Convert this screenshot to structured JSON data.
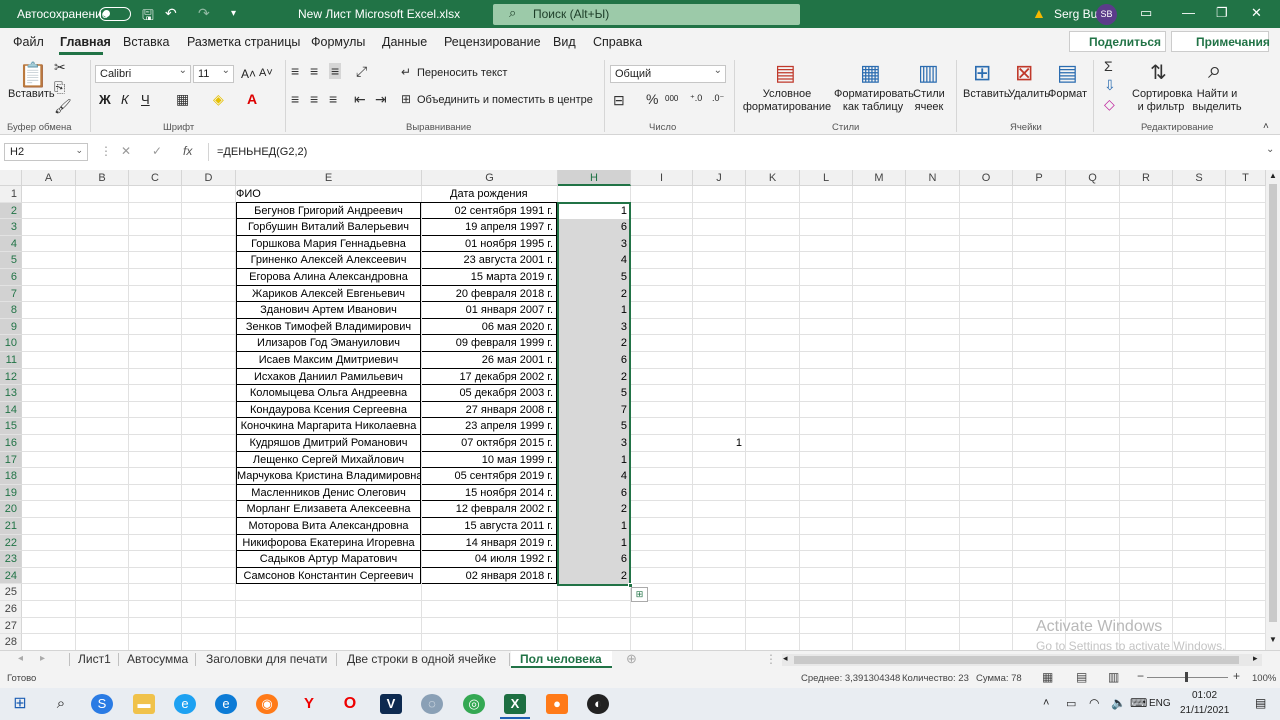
{
  "titlebar": {
    "autosave_label": "Автосохранение",
    "filename": "New Лист Microsoft Excel.xlsx",
    "search_placeholder": "Поиск (Alt+Ы)",
    "user_name": "Serg Bul",
    "user_initials": "SB"
  },
  "menu": {
    "items": [
      "Файл",
      "Главная",
      "Вставка",
      "Разметка страницы",
      "Формулы",
      "Данные",
      "Рецензирование",
      "Вид",
      "Справка"
    ],
    "active": "Главная",
    "share_label": "Поделиться",
    "notes_label": "Примечания"
  },
  "ribbon": {
    "paste_label": "Вставить",
    "clipboard_group": "Буфер обмена",
    "font_name": "Calibri",
    "font_size": "11",
    "font_group": "Шрифт",
    "wrap_text": "Переносить текст",
    "merge_center": "Объединить и поместить в центре",
    "alignment_group": "Выравнивание",
    "number_format": "Общий",
    "number_group": "Число",
    "conditional_formatting": "Условное форматирование",
    "format_as_table": "Форматировать как таблицу",
    "cell_styles": "Стили ячеек",
    "styles_group": "Стили",
    "insert_label": "Вставить",
    "delete_label": "Удалить",
    "format_label": "Формат",
    "cells_group": "Ячейки",
    "sort_filter": "Сортировка и фильтр",
    "find_select": "Найти и выделить",
    "editing_group": "Редактирование"
  },
  "formula_bar": {
    "name_box": "H2",
    "formula": "=ДЕНЬНЕД(G2,2)"
  },
  "grid": {
    "columns": [
      "A",
      "B",
      "C",
      "D",
      "E",
      "G",
      "H",
      "I",
      "J",
      "K",
      "L",
      "M",
      "N",
      "O",
      "P",
      "Q",
      "R",
      "S",
      "T"
    ],
    "selected_column": "H",
    "header_fio": "ФИО",
    "header_dob": "Дата рождения",
    "rows": [
      {
        "fio": "Бегунов Григорий Андреевич",
        "dob": "02 сентября 1991 г.",
        "h": "1"
      },
      {
        "fio": "Горбушин Виталий Валерьевич",
        "dob": "19 апреля 1997 г.",
        "h": "6"
      },
      {
        "fio": "Горшкова Мария Геннадьевна",
        "dob": "01 ноября 1995 г.",
        "h": "3"
      },
      {
        "fio": "Гриненко Алексей Алексеевич",
        "dob": "23 августа 2001 г.",
        "h": "4"
      },
      {
        "fio": "Егорова Алина Александровна",
        "dob": "15 марта 2019 г.",
        "h": "5"
      },
      {
        "fio": "Жариков Алексей Евгеньевич",
        "dob": "20 февраля 2018 г.",
        "h": "2"
      },
      {
        "fio": "Зданович Артем Иванович",
        "dob": "01 января 2007 г.",
        "h": "1"
      },
      {
        "fio": "Зенков Тимофей Владимирович",
        "dob": "06 мая 2020 г.",
        "h": "3"
      },
      {
        "fio": "Илизаров Год Эмануилович",
        "dob": "09 февраля 1999 г.",
        "h": "2"
      },
      {
        "fio": "Исаев Максим Дмитриевич",
        "dob": "26 мая 2001 г.",
        "h": "6"
      },
      {
        "fio": "Исхаков Даниил Рамильевич",
        "dob": "17 декабря 2002 г.",
        "h": "2"
      },
      {
        "fio": "Коломыцева Ольга Андреевна",
        "dob": "05 декабря 2003 г.",
        "h": "5"
      },
      {
        "fio": "Кондаурова Ксения Сергеевна",
        "dob": "27 января 2008 г.",
        "h": "7"
      },
      {
        "fio": "Коночкина Маргарита Николаевна",
        "dob": "23 апреля 1999 г.",
        "h": "5"
      },
      {
        "fio": "Кудряшов Дмитрий Романович",
        "dob": "07 октября 2015 г.",
        "h": "3"
      },
      {
        "fio": "Лещенко Сергей Михайлович",
        "dob": "10 мая 1999 г.",
        "h": "1"
      },
      {
        "fio": "Марчукова Кристина Владимировна",
        "dob": "05 сентября 2019 г.",
        "h": "4"
      },
      {
        "fio": "Масленников Денис Олегович",
        "dob": "15 ноября 2014 г.",
        "h": "6"
      },
      {
        "fio": "Морланг Елизавета Алексеевна",
        "dob": "12 февраля 2002 г.",
        "h": "2"
      },
      {
        "fio": "Моторова Вита Александровна",
        "dob": "15 августа 2011 г.",
        "h": "1"
      },
      {
        "fio": "Никифорова Екатерина Игоревна",
        "dob": "14 января 2019 г.",
        "h": "1"
      },
      {
        "fio": "Садыков Артур Маратович",
        "dob": "04 июля 1992 г.",
        "h": "6"
      },
      {
        "fio": "Самсонов Константин Сергеевич",
        "dob": "02 января 2018 г.",
        "h": "2"
      }
    ],
    "j16_value": "1"
  },
  "watermark": {
    "line1": "Activate Windows",
    "line2": "Go to Settings to activate Windows."
  },
  "sheets": {
    "tabs": [
      "Лист1",
      "Автосумма",
      "Заголовки для печати",
      "Две строки в одной ячейке",
      "Пол человека"
    ],
    "active": "Пол человека"
  },
  "status": {
    "ready": "Готово",
    "average": "Среднее: 3,391304348",
    "count": "Количество: 23",
    "sum": "Сумма: 78",
    "zoom": "100%"
  },
  "taskbar": {
    "lang": "ENG",
    "time": "01:02",
    "date": "21/11/2021"
  }
}
